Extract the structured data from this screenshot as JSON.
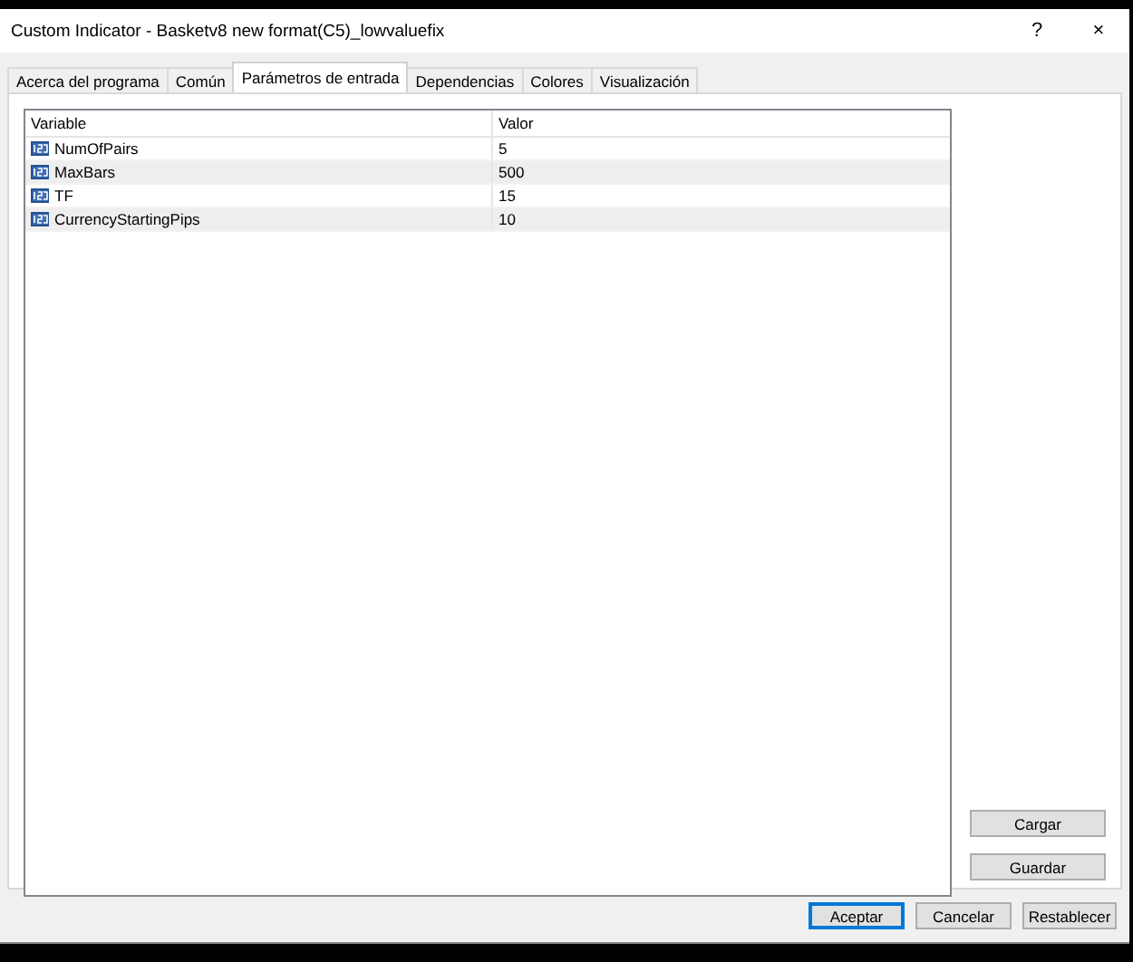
{
  "window": {
    "title": "Custom Indicator - Basketv8 new format(C5)_lowvaluefix",
    "help": "?",
    "close": "×"
  },
  "tabs": [
    {
      "label": "Acerca del programa",
      "selected": false
    },
    {
      "label": "Común",
      "selected": false
    },
    {
      "label": "Parámetros de entrada",
      "selected": true
    },
    {
      "label": "Dependencias",
      "selected": false
    },
    {
      "label": "Colores",
      "selected": false
    },
    {
      "label": "Visualización",
      "selected": false
    }
  ],
  "table": {
    "columns": [
      "Variable",
      "Valor"
    ],
    "rows": [
      {
        "variable": "NumOfPairs",
        "value": "5"
      },
      {
        "variable": "MaxBars",
        "value": "500"
      },
      {
        "variable": "TF",
        "value": "15"
      },
      {
        "variable": "CurrencyStartingPips",
        "value": "10"
      }
    ]
  },
  "side_buttons": [
    "Cargar",
    "Guardar"
  ],
  "buttons": [
    {
      "label": "Aceptar",
      "default": true
    },
    {
      "label": "Cancelar",
      "default": false
    },
    {
      "label": "Restablecer",
      "default": false
    }
  ]
}
